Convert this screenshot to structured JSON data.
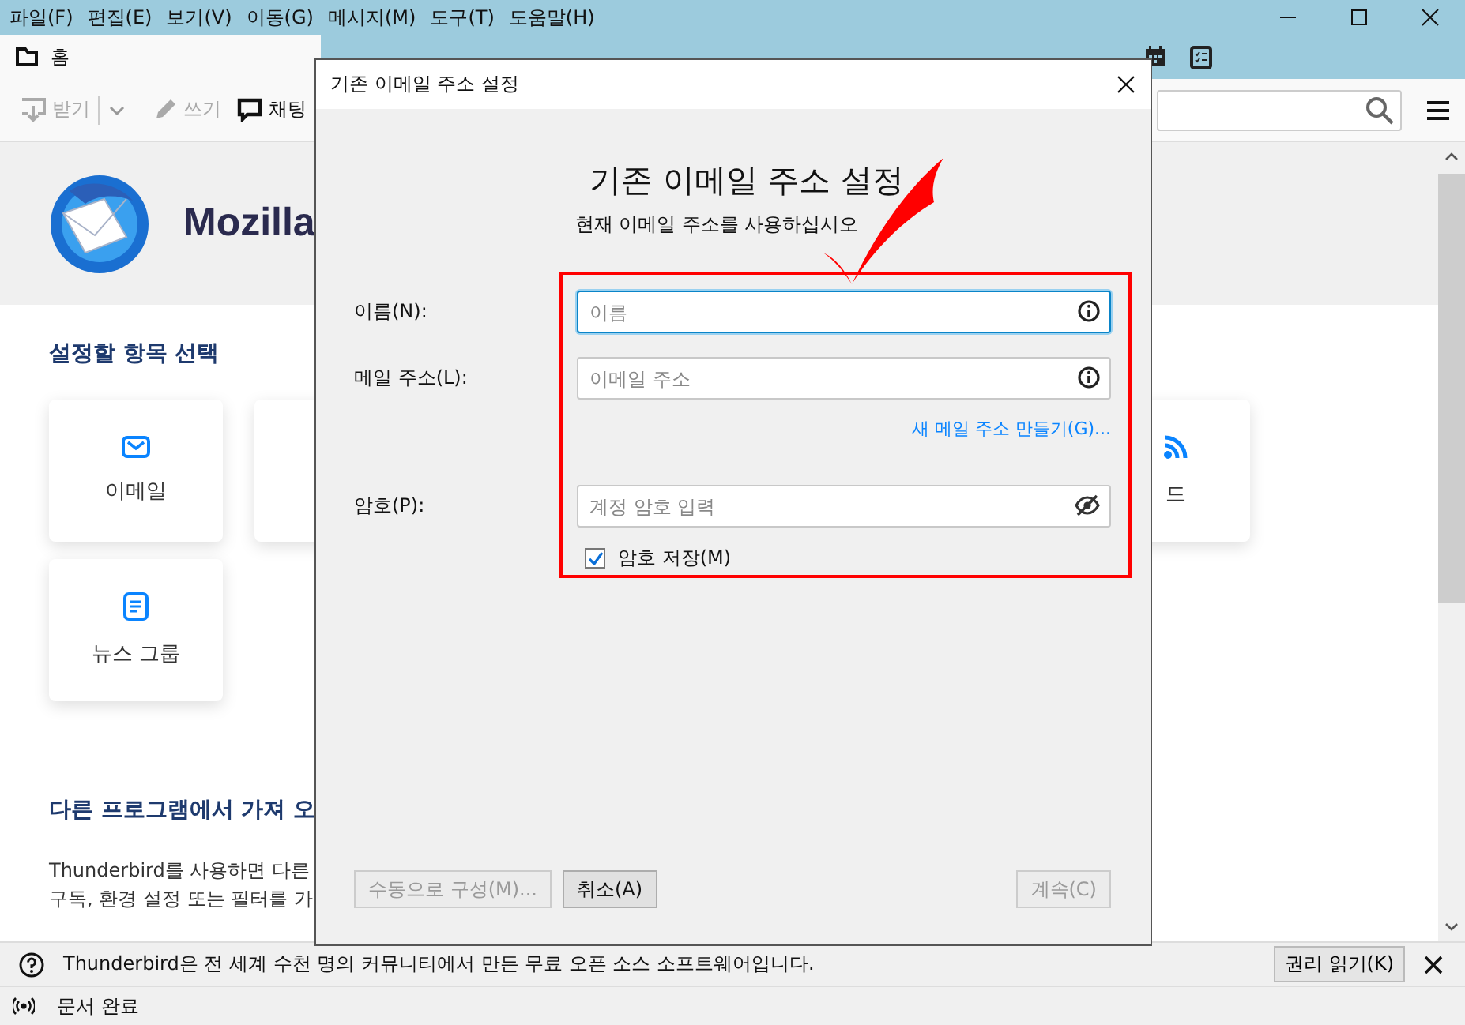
{
  "menu_bar": [
    "파일(F)",
    "편집(E)",
    "보기(V)",
    "이동(G)",
    "메시지(M)",
    "도구(T)",
    "도움말(H)"
  ],
  "tabs": [
    {
      "label": "홈",
      "selected": true
    }
  ],
  "toolbar": {
    "buttons": [
      {
        "label": "받기",
        "kind": "get",
        "disabled": true
      },
      {
        "label": "쓰기",
        "kind": "write",
        "disabled": true
      },
      {
        "label": "채팅",
        "kind": "chat",
        "disabled": false
      }
    ]
  },
  "home": {
    "brand": "Mozilla",
    "section_title": "설정할 항목 선택",
    "cards": [
      {
        "kind": "email",
        "label": "이메일"
      },
      {
        "kind": "blank"
      },
      {
        "kind": "feed",
        "label": "드"
      },
      {
        "kind": "news",
        "label": "뉴스 그룹"
      }
    ],
    "import_title": "다른 프로그램에서 가져 오",
    "import_text": [
      "Thunderbird를 사용하면 다른",
      "구독, 환경 설정 또는 필터를 가"
    ]
  },
  "notification": {
    "text": "Thunderbird은 전 세계 수천 명의 커뮤니티에서 만든 무료 오픈 소스 소프트웨어입니다.",
    "button": "권리 읽기(K)"
  },
  "status_bar": "문서 완료",
  "dialog": {
    "title": "기존 이메일 주소 설정",
    "heading": "기존 이메일 주소 설정",
    "subheading": "현재 이메일 주소를 사용하십시오",
    "fields": [
      {
        "label": "이름(N):",
        "placeholder": "이름",
        "kind": "info",
        "focused": true
      },
      {
        "label": "메일 주소(L):",
        "placeholder": "이메일 주소",
        "kind": "info",
        "focused": false
      },
      {
        "label": "암호(P):",
        "placeholder": "계정 암호 입력",
        "kind": "password",
        "focused": false
      }
    ],
    "link": "새 메일 주소 만들기(G)...",
    "checkbox": {
      "label": "암호 저장(M)",
      "checked": true
    },
    "buttons": [
      {
        "label": "수동으로 구성(M)...",
        "disabled": true
      },
      {
        "label": "취소(A)",
        "disabled": false
      },
      {
        "label": "계속(C)",
        "disabled": true
      }
    ]
  }
}
